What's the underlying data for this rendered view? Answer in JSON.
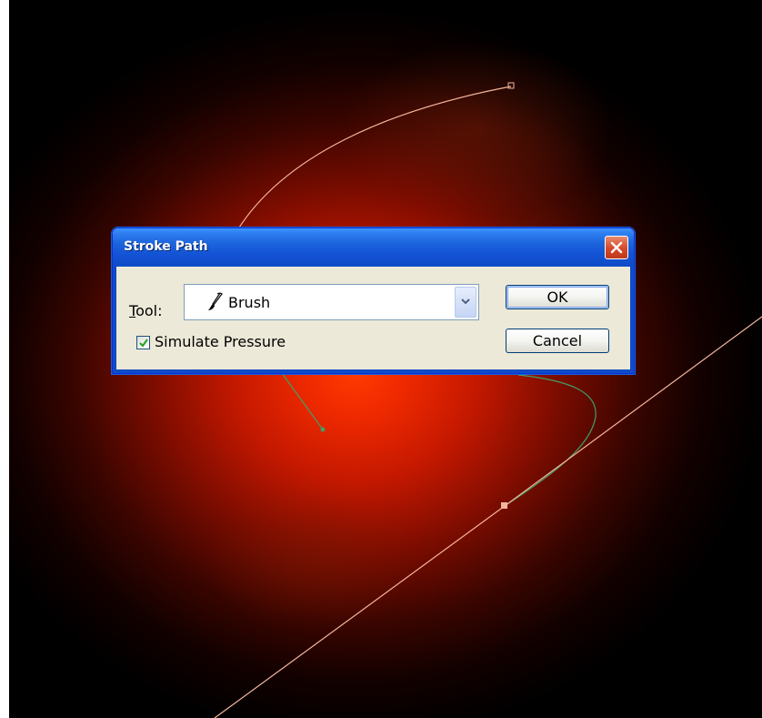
{
  "dialog": {
    "title": "Stroke Path",
    "tool_label_underlined": "T",
    "tool_label_rest": "ool:",
    "tool_value": "Brush",
    "simulate_pressure_label": "Simulate Pressure",
    "simulate_pressure_checked": true,
    "ok_label": "OK",
    "cancel_label": "Cancel"
  },
  "icons": {
    "close": "close-icon",
    "brush": "brush-icon",
    "dropdown": "chevron-down-icon",
    "check": "checkmark-icon"
  },
  "colors": {
    "path_stroke": "#f5b59a",
    "active_path_stroke": "#3fa06a",
    "title_bar": "#1c63dc",
    "close_button": "#d4492a"
  }
}
